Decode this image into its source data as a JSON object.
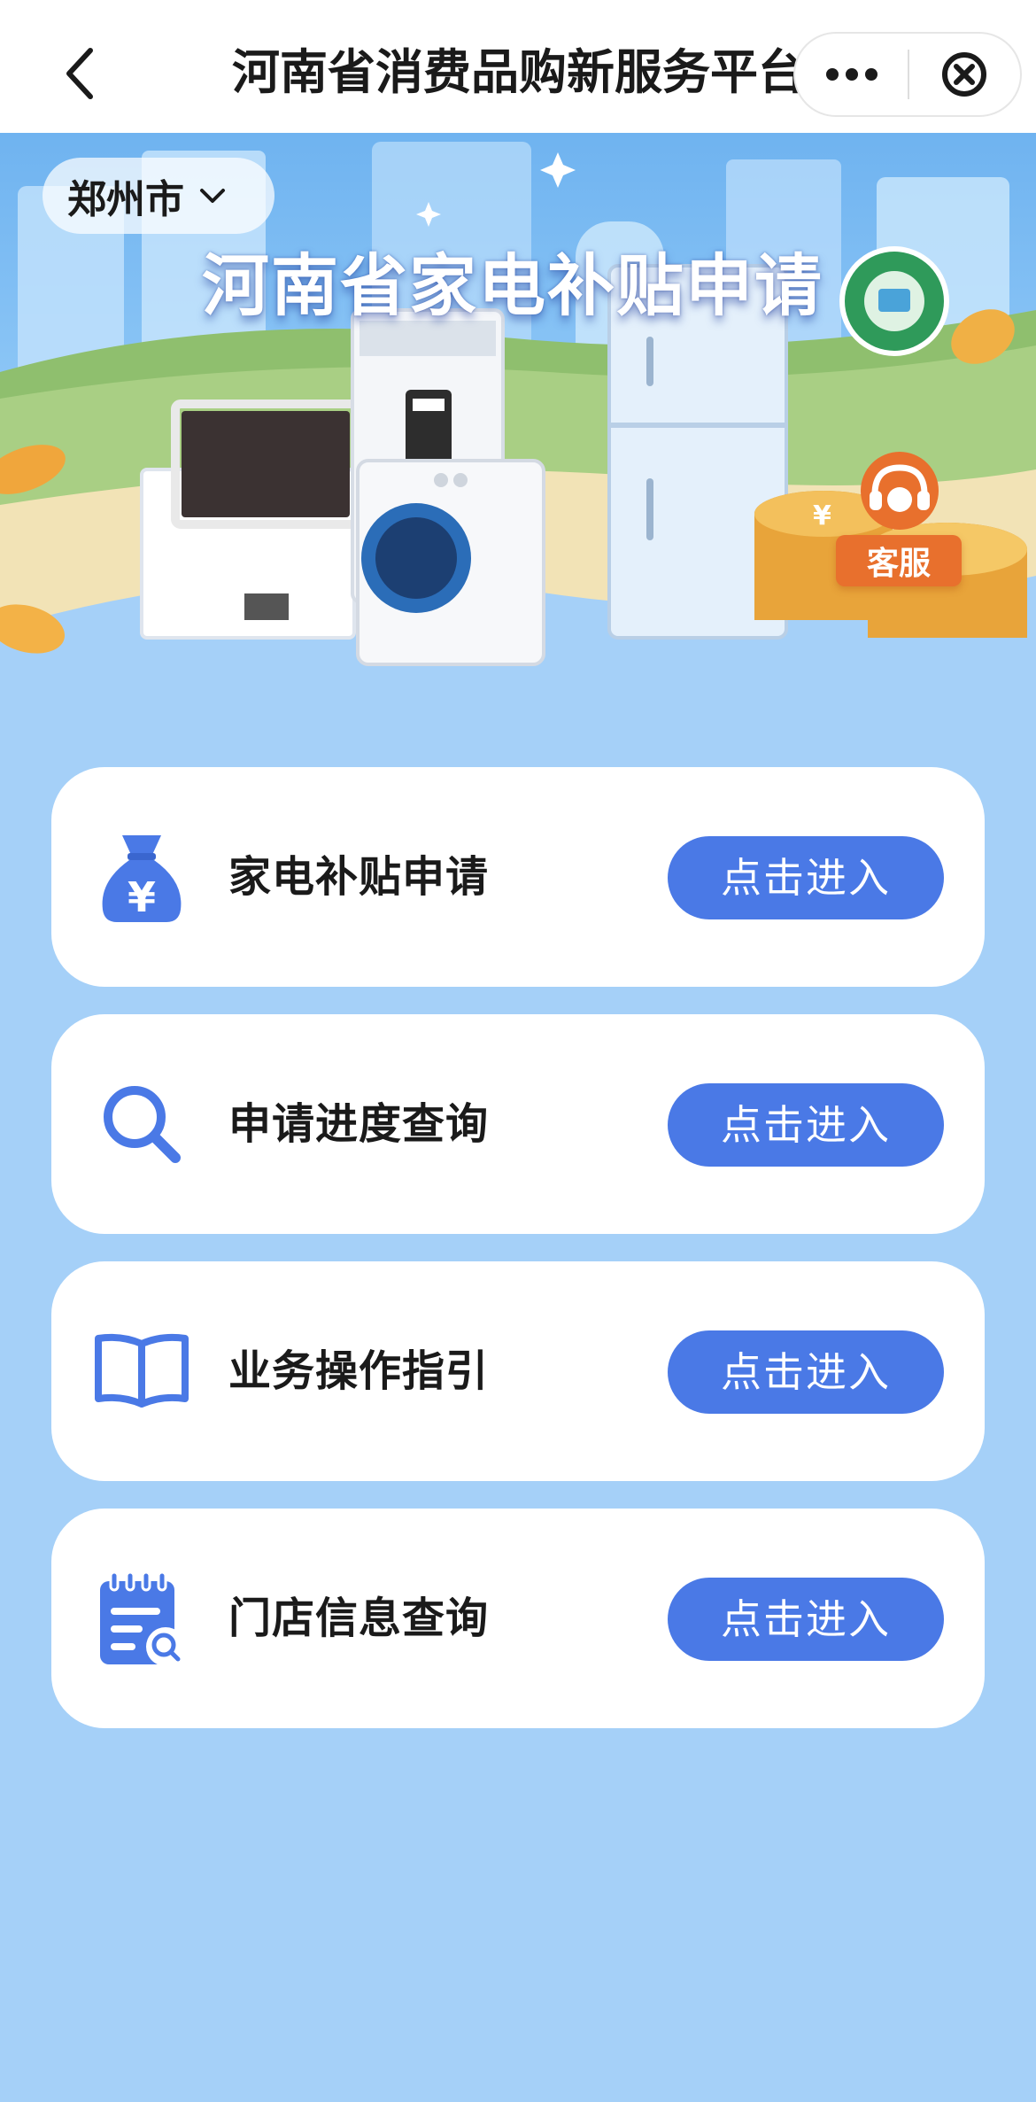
{
  "nav": {
    "title": "河南省消费品购新服务平台",
    "back_icon": "chevron-left-icon",
    "more_icon": "more-dots-icon",
    "close_icon": "close-circle-icon"
  },
  "banner": {
    "city": "郑州市",
    "title": "河南省家电补贴申请",
    "customer_service_label": "客服"
  },
  "menu": {
    "items": [
      {
        "label": "家电补贴申请",
        "button": "点击进入",
        "icon": "money-bag-icon"
      },
      {
        "label": "申请进度查询",
        "button": "点击进入",
        "icon": "search-icon"
      },
      {
        "label": "业务操作指引",
        "button": "点击进入",
        "icon": "book-icon"
      },
      {
        "label": "门店信息查询",
        "button": "点击进入",
        "icon": "store-query-icon"
      }
    ]
  },
  "colors": {
    "page_bg": "#a5d0f8",
    "accent": "#4a79e6",
    "service_orange": "#e8702d"
  }
}
